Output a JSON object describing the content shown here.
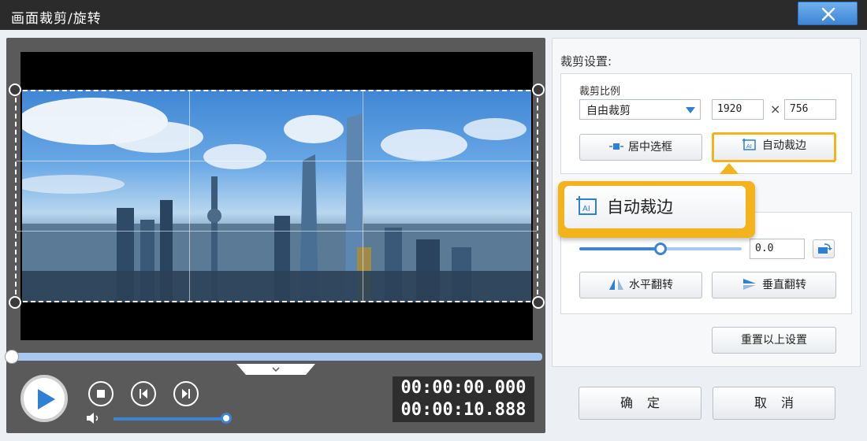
{
  "window": {
    "title": "画面裁剪/旋转",
    "close_icon": "close-icon"
  },
  "preview": {
    "progress_fraction": 0.0,
    "volume_fraction": 1.0,
    "timecode": {
      "current": "00:00:00.000",
      "total": "00:00:10.888"
    },
    "icons": {
      "play": "play-icon",
      "stop": "stop-icon",
      "prev": "previous-frame-icon",
      "next": "next-frame-icon",
      "volume": "volume-icon",
      "expand": "chevron-down-icon"
    }
  },
  "crop": {
    "section_title": "裁剪设置:",
    "ratio_label": "裁剪比例",
    "ratio_selected": "自由裁剪",
    "width": "1920",
    "height": "756",
    "times_symbol": "×",
    "center_button": "居中选框",
    "auto_button": "自动裁边"
  },
  "rotate": {
    "angle": "0.0",
    "slider_fraction": 0.5,
    "flip_horizontal": "水平翻转",
    "flip_vertical": "垂直翻转",
    "reset_button": "重置以上设置"
  },
  "callout": {
    "label": "自动裁边"
  },
  "footer": {
    "ok": "确定",
    "cancel": "取消"
  },
  "colors": {
    "accent_blue": "#3d85d4",
    "highlight_yellow": "#f2b31c",
    "titlebar": "#2b2b2b"
  }
}
